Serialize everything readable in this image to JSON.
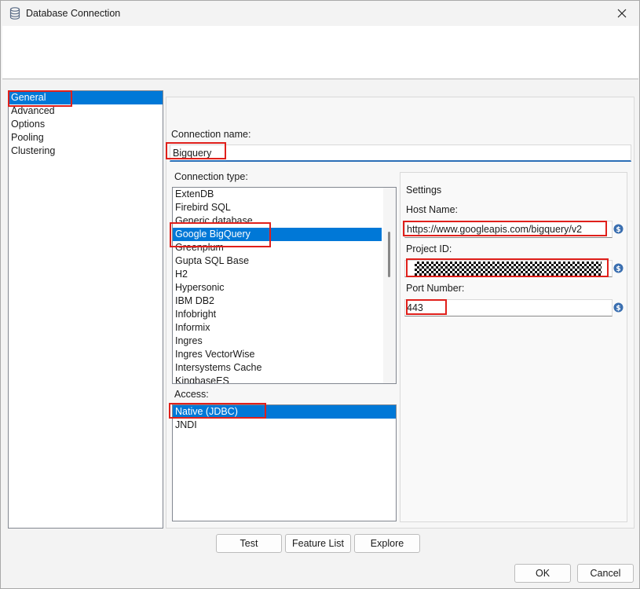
{
  "window": {
    "title": "Database Connection",
    "close_icon": "close-icon",
    "db_icon": "database-icon"
  },
  "nav": {
    "items": [
      {
        "label": "General",
        "selected": true
      },
      {
        "label": "Advanced"
      },
      {
        "label": "Options"
      },
      {
        "label": "Pooling"
      },
      {
        "label": "Clustering"
      }
    ]
  },
  "connection": {
    "name_label": "Connection name:",
    "name_value": "Bigquery"
  },
  "connection_type": {
    "label": "Connection type:",
    "items": [
      "ExtenDB",
      "Firebird SQL",
      "Generic database",
      "Google BigQuery",
      "Greenplum",
      "Gupta SQL Base",
      "H2",
      "Hypersonic",
      "IBM DB2",
      "Infobright",
      "Informix",
      "Ingres",
      "Ingres VectorWise",
      "Intersystems Cache",
      "KingbaseES"
    ],
    "selected": "Google BigQuery"
  },
  "access": {
    "label": "Access:",
    "items": [
      "Native (JDBC)",
      "JNDI"
    ],
    "selected": "Native (JDBC)"
  },
  "settings": {
    "title": "Settings",
    "host_label": "Host Name:",
    "host_value": "https://www.googleapis.com/bigquery/v2",
    "project_label": "Project ID:",
    "project_value": "",
    "port_label": "Port Number:",
    "port_value": "443",
    "variable_icon": "dollar-variable-icon"
  },
  "buttons": {
    "test": "Test",
    "feature_list": "Feature List",
    "explore": "Explore",
    "ok": "OK",
    "cancel": "Cancel"
  },
  "colors": {
    "selection": "#0078d7",
    "highlight": "#e0201b",
    "accent_underline": "#2c6fb7"
  }
}
